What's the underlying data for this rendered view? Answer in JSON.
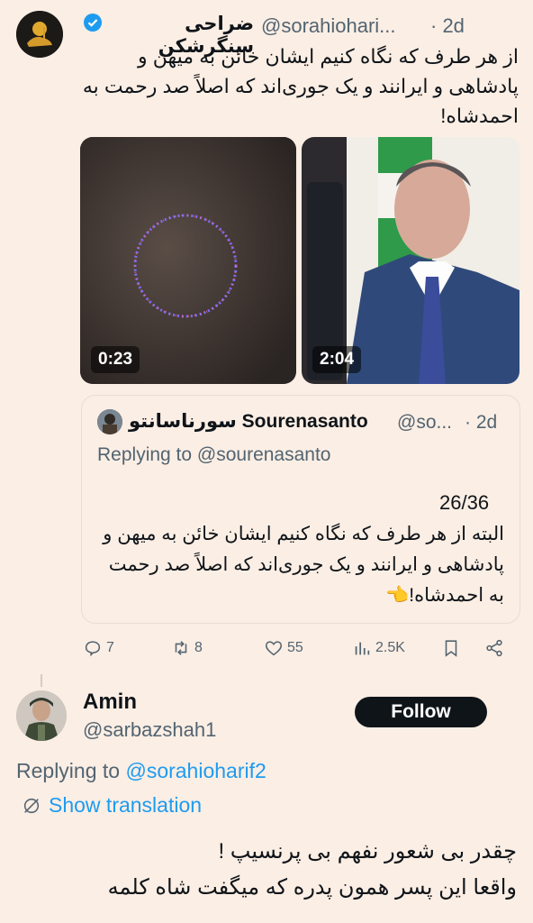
{
  "tweet": {
    "display_name": "ضراحی سنگرشکن",
    "handle": "@sorahiohari...",
    "time": "· 2d",
    "text": "از هر طرف که نگاه کنیم ایشان خائن به میهن و پادشاهی و ایرانند و یک جوری‌اند که اصلاً صد رحمت به احمدشاه!",
    "media": [
      {
        "duration": "0:23",
        "description": "dark video with circular light ring"
      },
      {
        "duration": "2:04",
        "description": "man in suit in front of Iranian flag"
      }
    ],
    "quoted": {
      "display_name": "سورناسانتو Sourenasanto",
      "handle": "@so...",
      "time": "· 2d",
      "replying": "Replying to @sourenasanto",
      "count": "26/36",
      "text": "البته از هر طرف که نگاه کنیم ایشان خائن به میهن و پادشاهی و ایرانند و یک جوری‌اند که اصلاً صد رحمت به احمدشاه!👈"
    },
    "actions": {
      "replies": "7",
      "retweets": "8",
      "likes": "55",
      "views": "2.5K"
    }
  },
  "reply": {
    "display_name": "Amin",
    "handle": "@sarbazshah1",
    "follow_label": "Follow",
    "replying_prefix": "Replying to ",
    "replying_handle": "@sorahioharif2",
    "show_translation": "Show translation",
    "line1": "چقدر بی شعور نفهم بی پرنسیپ !",
    "line2": "واقعا این پسر همون پدره که میگفت شاه کلمه"
  }
}
